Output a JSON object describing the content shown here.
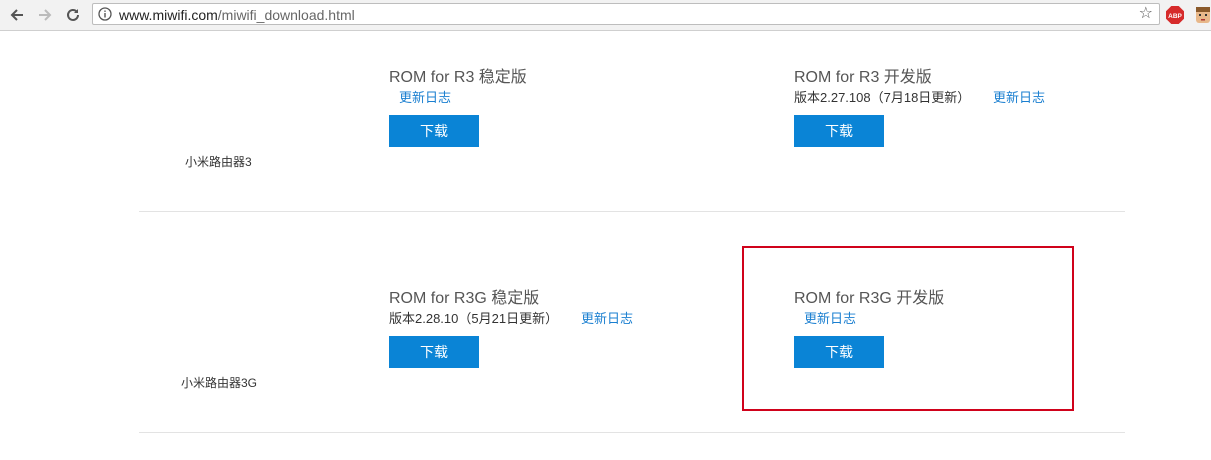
{
  "browser": {
    "url_host": "www.miwifi.com",
    "url_path": "/miwifi_download.html",
    "abp_label": "ABP"
  },
  "products": [
    {
      "name": "小米路由器3",
      "stable": {
        "title": "ROM for R3 稳定版",
        "version": "",
        "changelog": "更新日志",
        "download": "下载"
      },
      "dev": {
        "title": "ROM for R3 开发版",
        "version": "版本2.27.108（7月18日更新）",
        "changelog": "更新日志",
        "download": "下载"
      }
    },
    {
      "name": "小米路由器3G",
      "stable": {
        "title": "ROM for R3G 稳定版",
        "version": "版本2.28.10（5月21日更新）",
        "changelog": "更新日志",
        "download": "下载"
      },
      "dev": {
        "title": "ROM for R3G 开发版",
        "version": "",
        "changelog": "更新日志",
        "download": "下载"
      }
    }
  ],
  "colors": {
    "button": "#0a84d6",
    "link": "#1a7fd0",
    "highlight": "#d0021b"
  }
}
